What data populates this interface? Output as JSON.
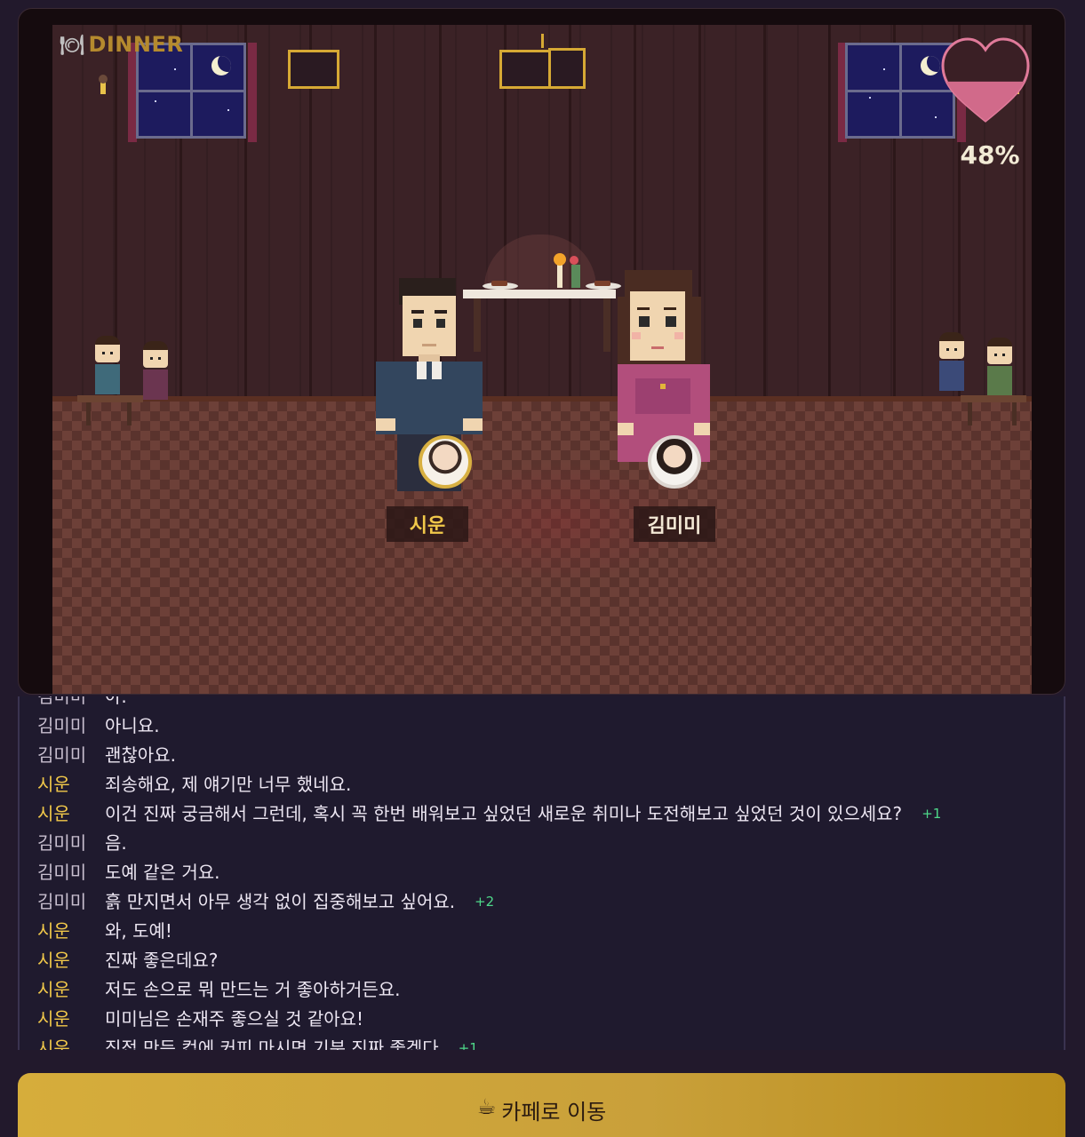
{
  "scene": {
    "label": "DINNER",
    "label_icon": "🍽",
    "affection_percent": "48%",
    "affection_value": 0.48
  },
  "characters": {
    "player": {
      "name": "시운"
    },
    "partner": {
      "name": "김미미"
    }
  },
  "chat": {
    "messages": [
      {
        "speaker": "김미미",
        "role": "kimmimi",
        "text": "아.",
        "score": ""
      },
      {
        "speaker": "김미미",
        "role": "kimmimi",
        "text": "아니요.",
        "score": ""
      },
      {
        "speaker": "김미미",
        "role": "kimmimi",
        "text": "괜찮아요.",
        "score": ""
      },
      {
        "speaker": "시운",
        "role": "siwoon",
        "text": "죄송해요, 제 얘기만 너무 했네요.",
        "score": ""
      },
      {
        "speaker": "시운",
        "role": "siwoon",
        "text": "이건 진짜 궁금해서 그런데, 혹시 꼭 한번 배워보고 싶었던 새로운 취미나 도전해보고 싶었던 것이 있으세요?",
        "score": "+1"
      },
      {
        "speaker": "김미미",
        "role": "kimmimi",
        "text": "음.",
        "score": ""
      },
      {
        "speaker": "김미미",
        "role": "kimmimi",
        "text": "도예 같은 거요.",
        "score": ""
      },
      {
        "speaker": "김미미",
        "role": "kimmimi",
        "text": "흙 만지면서 아무 생각 없이 집중해보고 싶어요.",
        "score": "+2"
      },
      {
        "speaker": "시운",
        "role": "siwoon",
        "text": "와, 도예!",
        "score": ""
      },
      {
        "speaker": "시운",
        "role": "siwoon",
        "text": "진짜 좋은데요?",
        "score": ""
      },
      {
        "speaker": "시운",
        "role": "siwoon",
        "text": "저도 손으로 뭐 만드는 거 좋아하거든요.",
        "score": ""
      },
      {
        "speaker": "시운",
        "role": "siwoon",
        "text": "미미님은 손재주 좋으실 것 같아요!",
        "score": ""
      },
      {
        "speaker": "시운",
        "role": "siwoon",
        "text": "직접 만든 컵에 커피 마시면 기분 진짜 좋겠다",
        "score": "+1"
      }
    ]
  },
  "action": {
    "icon": "☕",
    "label": "카페로 이동"
  },
  "colors": {
    "accent": "#f1c84a",
    "score": "#4ed98a",
    "button": "#d6ad3b",
    "heart": "#e07a9a"
  }
}
